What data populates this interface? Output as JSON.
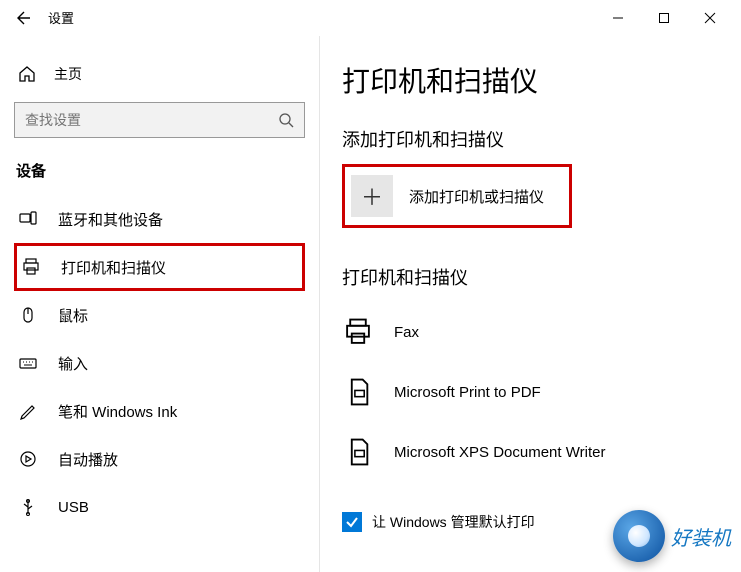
{
  "window": {
    "title": "设置"
  },
  "sidebar": {
    "home": "主页",
    "search_placeholder": "查找设置",
    "section": "设备",
    "items": [
      {
        "label": "蓝牙和其他设备"
      },
      {
        "label": "打印机和扫描仪"
      },
      {
        "label": "鼠标"
      },
      {
        "label": "输入"
      },
      {
        "label": "笔和 Windows Ink"
      },
      {
        "label": "自动播放"
      },
      {
        "label": "USB"
      }
    ]
  },
  "content": {
    "title": "打印机和扫描仪",
    "add_section": "添加打印机和扫描仪",
    "add_label": "添加打印机或扫描仪",
    "list_section": "打印机和扫描仪",
    "printers": [
      {
        "label": "Fax"
      },
      {
        "label": "Microsoft Print to PDF"
      },
      {
        "label": "Microsoft XPS Document Writer"
      }
    ],
    "checkbox_label": "让 Windows 管理默认打印"
  },
  "watermark": "好装机"
}
